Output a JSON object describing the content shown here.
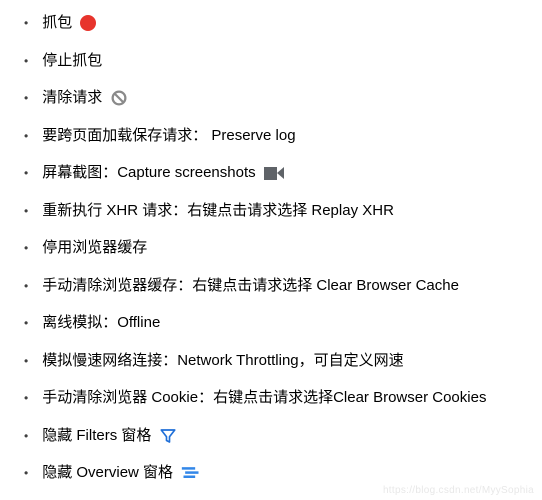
{
  "items": [
    {
      "text": "抓包",
      "icon": "record"
    },
    {
      "text": "停止抓包",
      "icon": null
    },
    {
      "text": "清除请求",
      "icon": "ban"
    },
    {
      "text": "要跨页面加载保存请求： Preserve log",
      "icon": null
    },
    {
      "text": "屏幕截图：Capture screenshots",
      "icon": "camera"
    },
    {
      "text": "重新执行 XHR 请求：右键点击请求选择 Replay XHR",
      "icon": null
    },
    {
      "text": "停用浏览器缓存",
      "icon": null
    },
    {
      "text": "手动清除浏览器缓存：右键点击请求选择 Clear Browser Cache",
      "icon": null
    },
    {
      "text": "离线模拟：Offline",
      "icon": null
    },
    {
      "text": "模拟慢速网络连接：Network Throttling，可自定义网速",
      "icon": null
    },
    {
      "text": "手动清除浏览器 Cookie：右键点击请求选择Clear Browser Cookies",
      "icon": null
    },
    {
      "text": "隐藏 Filters 窗格",
      "icon": "filter"
    },
    {
      "text": "隐藏 Overview 窗格",
      "icon": "overview"
    }
  ],
  "watermark": "https://blog.csdn.net/MyySophia"
}
